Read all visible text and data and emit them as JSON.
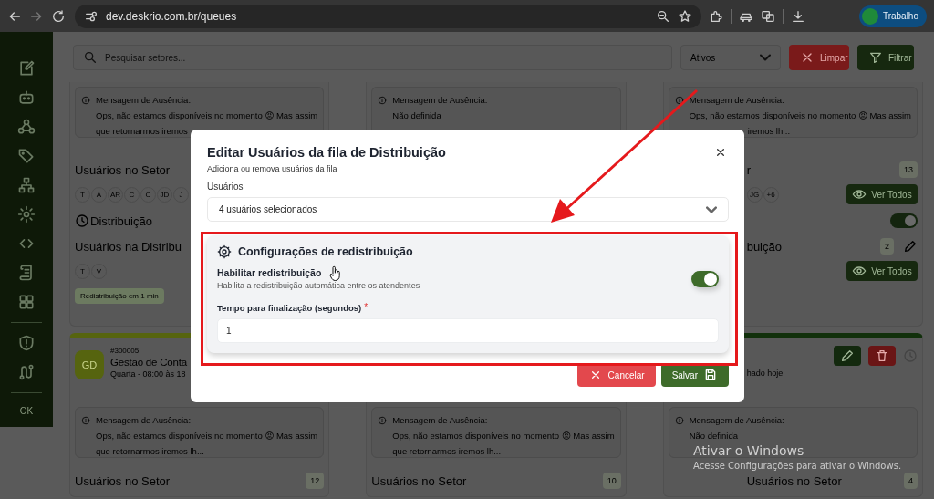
{
  "browser": {
    "url": "dev.deskrio.com.br/queues",
    "profile": "Trabalho"
  },
  "sidebar": {
    "footer": "OK"
  },
  "toolbar": {
    "search": {
      "placeholder": "Pesquisar setores..."
    },
    "status_filter": "Ativos",
    "buttons": [
      {
        "kind": "clear",
        "label": "Limpar"
      },
      {
        "kind": "filter",
        "label": "Filtrar"
      }
    ]
  },
  "card_rows": [
    {
      "cards": [
        {
          "covered": false,
          "message": {
            "label": "Mensagem de Ausência:",
            "lines": [
              "Ops, não estamos disponíveis no momento 😡 Mas assim",
              "que retornarmos iremos"
            ]
          },
          "sector_users": {
            "title": "Usuários no Setor",
            "avatars": [
              "T",
              "A",
              "AR",
              "C",
              "C",
              "JD",
              "J"
            ]
          },
          "distribution": {
            "title": "Distribuição"
          },
          "distribution_users": {
            "title": "Usuários na Distribu",
            "avatars": [
              "T",
              "V"
            ]
          },
          "badge": "Redistribuição em 1 min"
        },
        {
          "covered": false,
          "message": {
            "label": "Mensagem de Ausência:",
            "lines": [
              "Não definida"
            ]
          }
        },
        {
          "covered": true,
          "message": {
            "label": "Mensagem de Ausência:",
            "lines": [
              "Ops, não estamos disponíveis no momento 😡 Mas assim",
              "iremos lh..."
            ]
          },
          "sector_users": {
            "title": "r",
            "count": "13",
            "avatars": [
              "JG",
              "+6"
            ],
            "show_all": "Ver Todos"
          },
          "distribution": {
            "enabled": true
          },
          "distribution_users": {
            "title": "buição",
            "count": "2",
            "editable": true,
            "show_all": "Ver Todos"
          }
        }
      ]
    },
    {
      "cards": [
        {
          "covered": false,
          "header": {
            "color": "#56640f",
            "initials": "GD",
            "code": "#300005",
            "name": "Gestão de Conta",
            "schedule": "Quarta - 08:00 às 18"
          },
          "message": {
            "label": "Mensagem de Ausência:",
            "lines": [
              "Ops, não estamos disponíveis no momento 😡 Mas assim",
              "que retornarmos iremos lh..."
            ]
          },
          "sector_users": {
            "title": "Usuários no Setor",
            "count": "12"
          }
        },
        {
          "covered": false,
          "message": {
            "label": "Mensagem de Ausência:",
            "lines": [
              "Ops, não estamos disponíveis no momento 😡 Mas assim",
              "que retornarmos iremos lh..."
            ]
          },
          "sector_users": {
            "title": "Usuários no Setor",
            "count": "10"
          }
        },
        {
          "covered": true,
          "header": {
            "color": "#11300b",
            "actions": true,
            "schedule": "hado hoje"
          },
          "message": {
            "label": "Mensagem de Ausência:",
            "lines": [
              "Não definida"
            ]
          },
          "sector_users": {
            "title": "Usuários no Setor",
            "count": "4"
          }
        }
      ]
    }
  ],
  "modal": {
    "title": "Editar Usuários da fila de Distribuição",
    "subtitle": "Adiciona ou remova usuários da fila",
    "users_label": "Usuários",
    "users_value": "4 usuários selecionados",
    "redistribution": {
      "title": "Configurações de redistribuição",
      "toggle_label": "Habilitar redistribuição",
      "toggle_hint": "Habilita a redistribuição automática entre os atendentes",
      "enabled": true,
      "time_label": "Tempo para finalização (segundos)",
      "required_mark": "*",
      "time_value": "1"
    },
    "buttons": [
      {
        "kind": "cancel",
        "label": "Cancelar"
      },
      {
        "kind": "save",
        "label": "Salvar"
      }
    ]
  },
  "os_notice": {
    "title": "Ativar o Windows",
    "text": "Acesse Configurações para ativar o Windows."
  }
}
